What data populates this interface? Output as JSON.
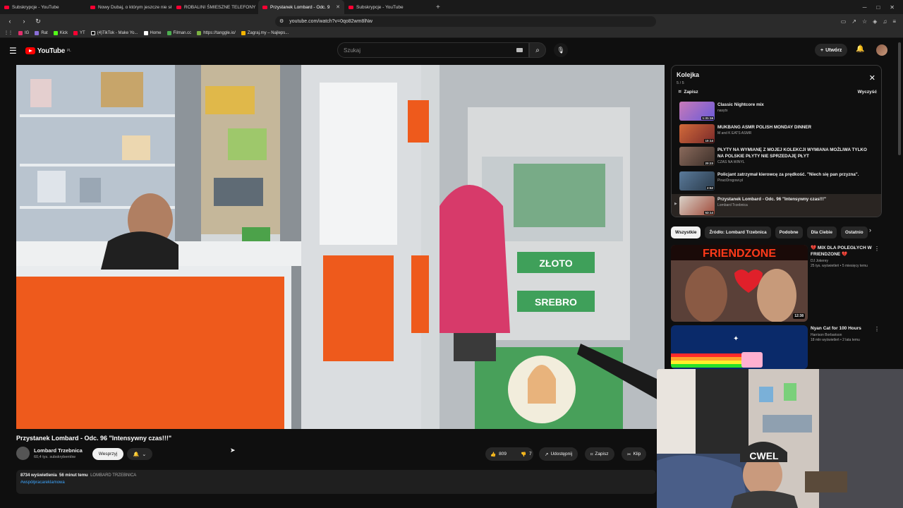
{
  "browser": {
    "tabs": [
      {
        "label": "Subskrypcje - YouTube",
        "active": false
      },
      {
        "label": "Nowy Dubaj, o którym jeszcze nie sł",
        "active": false
      },
      {
        "label": "ROBALINI ŚMIESZNE TELEFONY",
        "active": false
      },
      {
        "label": "Przystanek Lombard - Odc. 9",
        "active": true
      },
      {
        "label": "Subskrypcje - YouTube",
        "active": false
      }
    ],
    "url": "youtube.com/watch?v=0qo82wm8lNw",
    "bookmarks": [
      "IG",
      "Rat",
      "Kick",
      "YT",
      "(4)TikTok - Make Yo...",
      "Home",
      "Filman.cc",
      "https://tanggle.io/",
      "Zagraj.my – Najleps..."
    ]
  },
  "header": {
    "logo_text": "YouTube",
    "logo_region": "PL",
    "search_placeholder": "Szukaj",
    "create_label": "Utwórz"
  },
  "video": {
    "title": "Przystanek Lombard - Odc. 96 \"Intensywny czas!!!\"",
    "scene_text": {
      "sign1": "ZŁOTO",
      "sign2": "SREBRO",
      "badge": "LOMBARD TRZEBNICA"
    }
  },
  "channel": {
    "name": "Lombard Trzebnica",
    "subs": "60,4 tys. subskrybentów",
    "support_label": "Wesprzyj"
  },
  "actions": {
    "likes": "809",
    "dislikes": "7",
    "share": "Udostępnij",
    "save": "Zapisz",
    "clip": "Klip"
  },
  "description": {
    "views": "8734 wyświetlenia",
    "time": "56 minut temu",
    "channel_tag": "LOMBARD TRZEBNICA",
    "hashtag": "#współpracareklamowa"
  },
  "queue": {
    "title": "Kolejka",
    "count": "5 / 5",
    "save_label": "Zapisz",
    "clear_label": "Wyczyść",
    "items": [
      {
        "title": "Classic Nightcore mix",
        "author": "nasytx",
        "duration": "1:31:16",
        "color": "#c87ab8"
      },
      {
        "title": "MUKBANG ASMR POLISH MONDAY DINNER",
        "author": "M and K EATS ASMR",
        "duration": "10:14",
        "color": "#b0453a"
      },
      {
        "title": "PŁYTY NA WYMIANĘ Z MOJEJ KOLEKCJI WYMIANA MOŻLIWA TYLKO NA POLSKIE PŁYTY NIE SPRZEDAJĘ PŁYT",
        "author": "CZAS NA WINYL",
        "duration": "20:23",
        "color": "#6f5a4c"
      },
      {
        "title": "Policjant zatrzymał kierowcę za prędkość. \"Niech się pan przyzna\".",
        "author": "PiraciDrogowi.pl",
        "duration": "2:52",
        "color": "#4b6a8a"
      },
      {
        "title": "Przystanek Lombard - Odc. 96 \"Intensywny czas!!!\"",
        "author": "Lombard Trzebnica",
        "duration": "53:14",
        "color": "#a04a3a"
      }
    ]
  },
  "chips": [
    "Wszystkie",
    "Źródło: Lombard Trzebnica",
    "Podobne",
    "Dla Ciebie",
    "Ostatnio"
  ],
  "recommendations": [
    {
      "title": "💔 MIX DLA POLEGŁYCH W FRIENDZONE 💔",
      "channel": "DJ Jokerey",
      "meta": "25 tys. wyświetleń • 5 miesięcy temu",
      "duration": "12:38",
      "thumb_text": "FRIENDZONE"
    },
    {
      "title": "Nyan Cat for 100 Hours",
      "channel": "Harrison Borbarison",
      "meta": "18 mln wyświetleń • 2 lata temu",
      "duration": ""
    }
  ],
  "webcam": {
    "cap_text": "CWEL"
  }
}
